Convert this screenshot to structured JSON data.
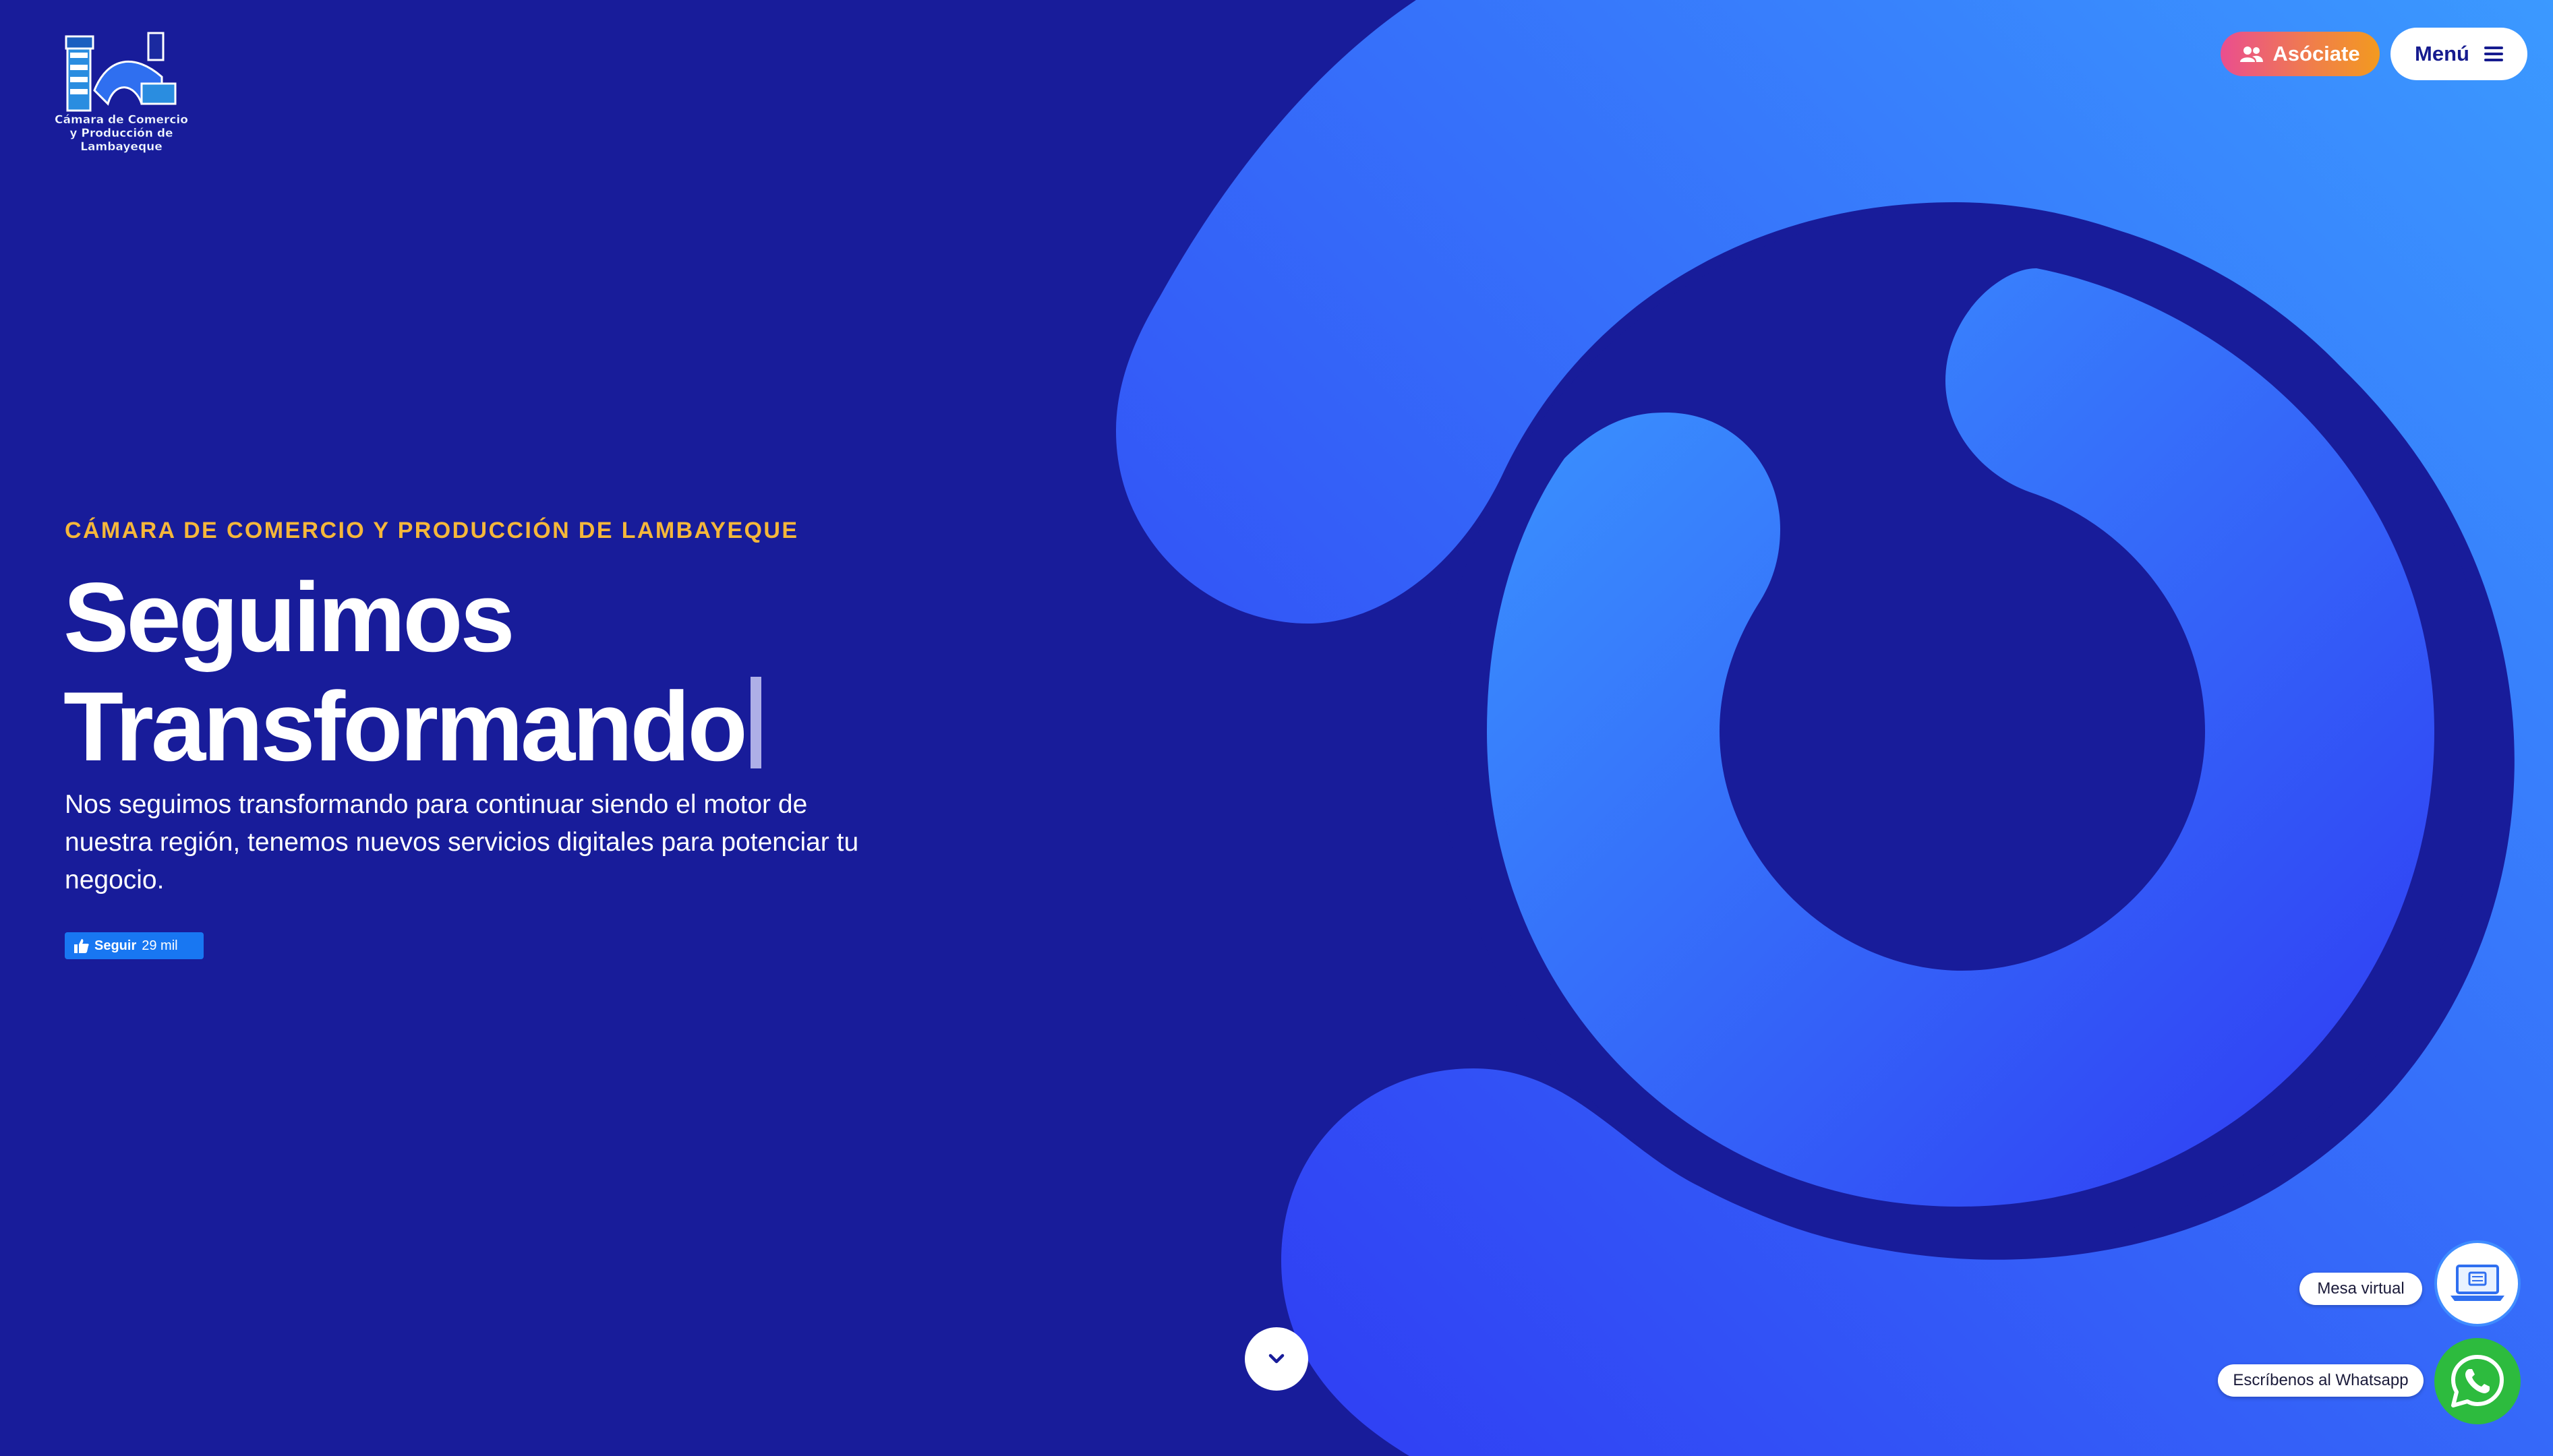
{
  "header": {
    "logo_text_line1": "Cámara de Comercio",
    "logo_text_line2": "y Producción de Lambayeque",
    "asociate_label": "Asóciate",
    "menu_label": "Menú"
  },
  "hero": {
    "eyebrow": "CÁMARA DE COMERCIO Y PRODUCCIÓN DE LAMBAYEQUE",
    "headline_line1": "Seguimos",
    "headline_line2": "Transformando",
    "description": "Nos seguimos transformando para continuar siendo el motor de nuestra región, tenemos nuevos servicios digitales para potenciar tu negocio.",
    "facebook_follow_label": "Seguir",
    "facebook_follow_count": "29 mil"
  },
  "floating": {
    "mesa_virtual_label": "Mesa virtual",
    "whatsapp_label": "Escríbenos al Whatsapp"
  },
  "icons": {
    "asociate": "users-icon",
    "menu": "hamburger-icon",
    "facebook": "thumbs-up-icon",
    "scroll": "chevron-down-icon",
    "mesa_virtual": "laptop-icon",
    "whatsapp": "whatsapp-icon"
  },
  "colors": {
    "background": "#181c9a",
    "eyebrow": "#f5b73a",
    "shape_light": "#3b99ff",
    "shape_dark": "#2f38f3",
    "whatsapp_green": "#2dbb3e",
    "facebook_blue": "#1877f2"
  }
}
